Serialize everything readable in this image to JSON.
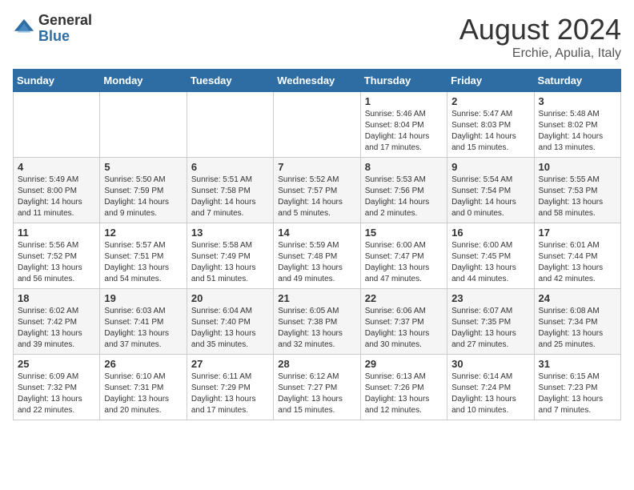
{
  "logo": {
    "general": "General",
    "blue": "Blue"
  },
  "title": {
    "month_year": "August 2024",
    "location": "Erchie, Apulia, Italy"
  },
  "weekdays": [
    "Sunday",
    "Monday",
    "Tuesday",
    "Wednesday",
    "Thursday",
    "Friday",
    "Saturday"
  ],
  "weeks": [
    [
      {
        "day": "",
        "info": ""
      },
      {
        "day": "",
        "info": ""
      },
      {
        "day": "",
        "info": ""
      },
      {
        "day": "",
        "info": ""
      },
      {
        "day": "1",
        "info": "Sunrise: 5:46 AM\nSunset: 8:04 PM\nDaylight: 14 hours and 17 minutes."
      },
      {
        "day": "2",
        "info": "Sunrise: 5:47 AM\nSunset: 8:03 PM\nDaylight: 14 hours and 15 minutes."
      },
      {
        "day": "3",
        "info": "Sunrise: 5:48 AM\nSunset: 8:02 PM\nDaylight: 14 hours and 13 minutes."
      }
    ],
    [
      {
        "day": "4",
        "info": "Sunrise: 5:49 AM\nSunset: 8:00 PM\nDaylight: 14 hours and 11 minutes."
      },
      {
        "day": "5",
        "info": "Sunrise: 5:50 AM\nSunset: 7:59 PM\nDaylight: 14 hours and 9 minutes."
      },
      {
        "day": "6",
        "info": "Sunrise: 5:51 AM\nSunset: 7:58 PM\nDaylight: 14 hours and 7 minutes."
      },
      {
        "day": "7",
        "info": "Sunrise: 5:52 AM\nSunset: 7:57 PM\nDaylight: 14 hours and 5 minutes."
      },
      {
        "day": "8",
        "info": "Sunrise: 5:53 AM\nSunset: 7:56 PM\nDaylight: 14 hours and 2 minutes."
      },
      {
        "day": "9",
        "info": "Sunrise: 5:54 AM\nSunset: 7:54 PM\nDaylight: 14 hours and 0 minutes."
      },
      {
        "day": "10",
        "info": "Sunrise: 5:55 AM\nSunset: 7:53 PM\nDaylight: 13 hours and 58 minutes."
      }
    ],
    [
      {
        "day": "11",
        "info": "Sunrise: 5:56 AM\nSunset: 7:52 PM\nDaylight: 13 hours and 56 minutes."
      },
      {
        "day": "12",
        "info": "Sunrise: 5:57 AM\nSunset: 7:51 PM\nDaylight: 13 hours and 54 minutes."
      },
      {
        "day": "13",
        "info": "Sunrise: 5:58 AM\nSunset: 7:49 PM\nDaylight: 13 hours and 51 minutes."
      },
      {
        "day": "14",
        "info": "Sunrise: 5:59 AM\nSunset: 7:48 PM\nDaylight: 13 hours and 49 minutes."
      },
      {
        "day": "15",
        "info": "Sunrise: 6:00 AM\nSunset: 7:47 PM\nDaylight: 13 hours and 47 minutes."
      },
      {
        "day": "16",
        "info": "Sunrise: 6:00 AM\nSunset: 7:45 PM\nDaylight: 13 hours and 44 minutes."
      },
      {
        "day": "17",
        "info": "Sunrise: 6:01 AM\nSunset: 7:44 PM\nDaylight: 13 hours and 42 minutes."
      }
    ],
    [
      {
        "day": "18",
        "info": "Sunrise: 6:02 AM\nSunset: 7:42 PM\nDaylight: 13 hours and 39 minutes."
      },
      {
        "day": "19",
        "info": "Sunrise: 6:03 AM\nSunset: 7:41 PM\nDaylight: 13 hours and 37 minutes."
      },
      {
        "day": "20",
        "info": "Sunrise: 6:04 AM\nSunset: 7:40 PM\nDaylight: 13 hours and 35 minutes."
      },
      {
        "day": "21",
        "info": "Sunrise: 6:05 AM\nSunset: 7:38 PM\nDaylight: 13 hours and 32 minutes."
      },
      {
        "day": "22",
        "info": "Sunrise: 6:06 AM\nSunset: 7:37 PM\nDaylight: 13 hours and 30 minutes."
      },
      {
        "day": "23",
        "info": "Sunrise: 6:07 AM\nSunset: 7:35 PM\nDaylight: 13 hours and 27 minutes."
      },
      {
        "day": "24",
        "info": "Sunrise: 6:08 AM\nSunset: 7:34 PM\nDaylight: 13 hours and 25 minutes."
      }
    ],
    [
      {
        "day": "25",
        "info": "Sunrise: 6:09 AM\nSunset: 7:32 PM\nDaylight: 13 hours and 22 minutes."
      },
      {
        "day": "26",
        "info": "Sunrise: 6:10 AM\nSunset: 7:31 PM\nDaylight: 13 hours and 20 minutes."
      },
      {
        "day": "27",
        "info": "Sunrise: 6:11 AM\nSunset: 7:29 PM\nDaylight: 13 hours and 17 minutes."
      },
      {
        "day": "28",
        "info": "Sunrise: 6:12 AM\nSunset: 7:27 PM\nDaylight: 13 hours and 15 minutes."
      },
      {
        "day": "29",
        "info": "Sunrise: 6:13 AM\nSunset: 7:26 PM\nDaylight: 13 hours and 12 minutes."
      },
      {
        "day": "30",
        "info": "Sunrise: 6:14 AM\nSunset: 7:24 PM\nDaylight: 13 hours and 10 minutes."
      },
      {
        "day": "31",
        "info": "Sunrise: 6:15 AM\nSunset: 7:23 PM\nDaylight: 13 hours and 7 minutes."
      }
    ]
  ]
}
